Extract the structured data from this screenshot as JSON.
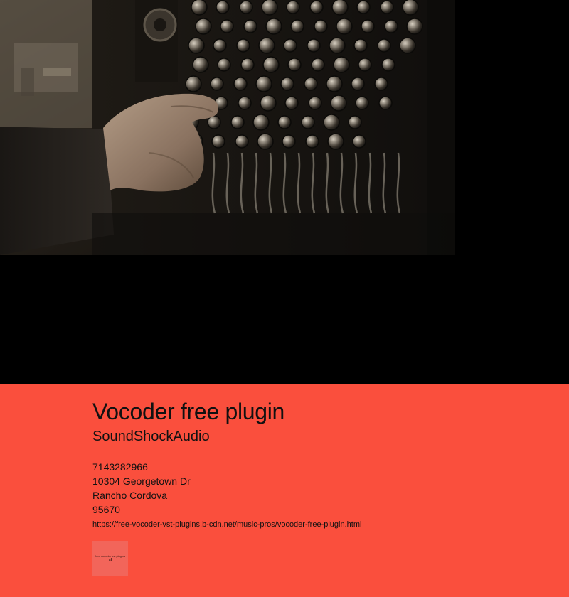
{
  "hero": {
    "image_alt": "Hand adjusting knobs on a vintage vocoder synthesizer panel"
  },
  "info": {
    "title": "Vocoder free plugin",
    "company": "SoundShockAudio",
    "phone": "7143282966",
    "street": "10304 Georgetown Dr",
    "city": "Rancho Cordova",
    "zip": "95670",
    "url": "https://free-vocoder-vst-plugins.b-cdn.net/music-pros/vocoder-free-plugin.html",
    "thumbnail": {
      "caption": "free vocoder vst plugins",
      "mark": "sl"
    }
  },
  "colors": {
    "accent_background": "#fa4f3d",
    "hero_background": "#000000",
    "text": "#111111"
  }
}
